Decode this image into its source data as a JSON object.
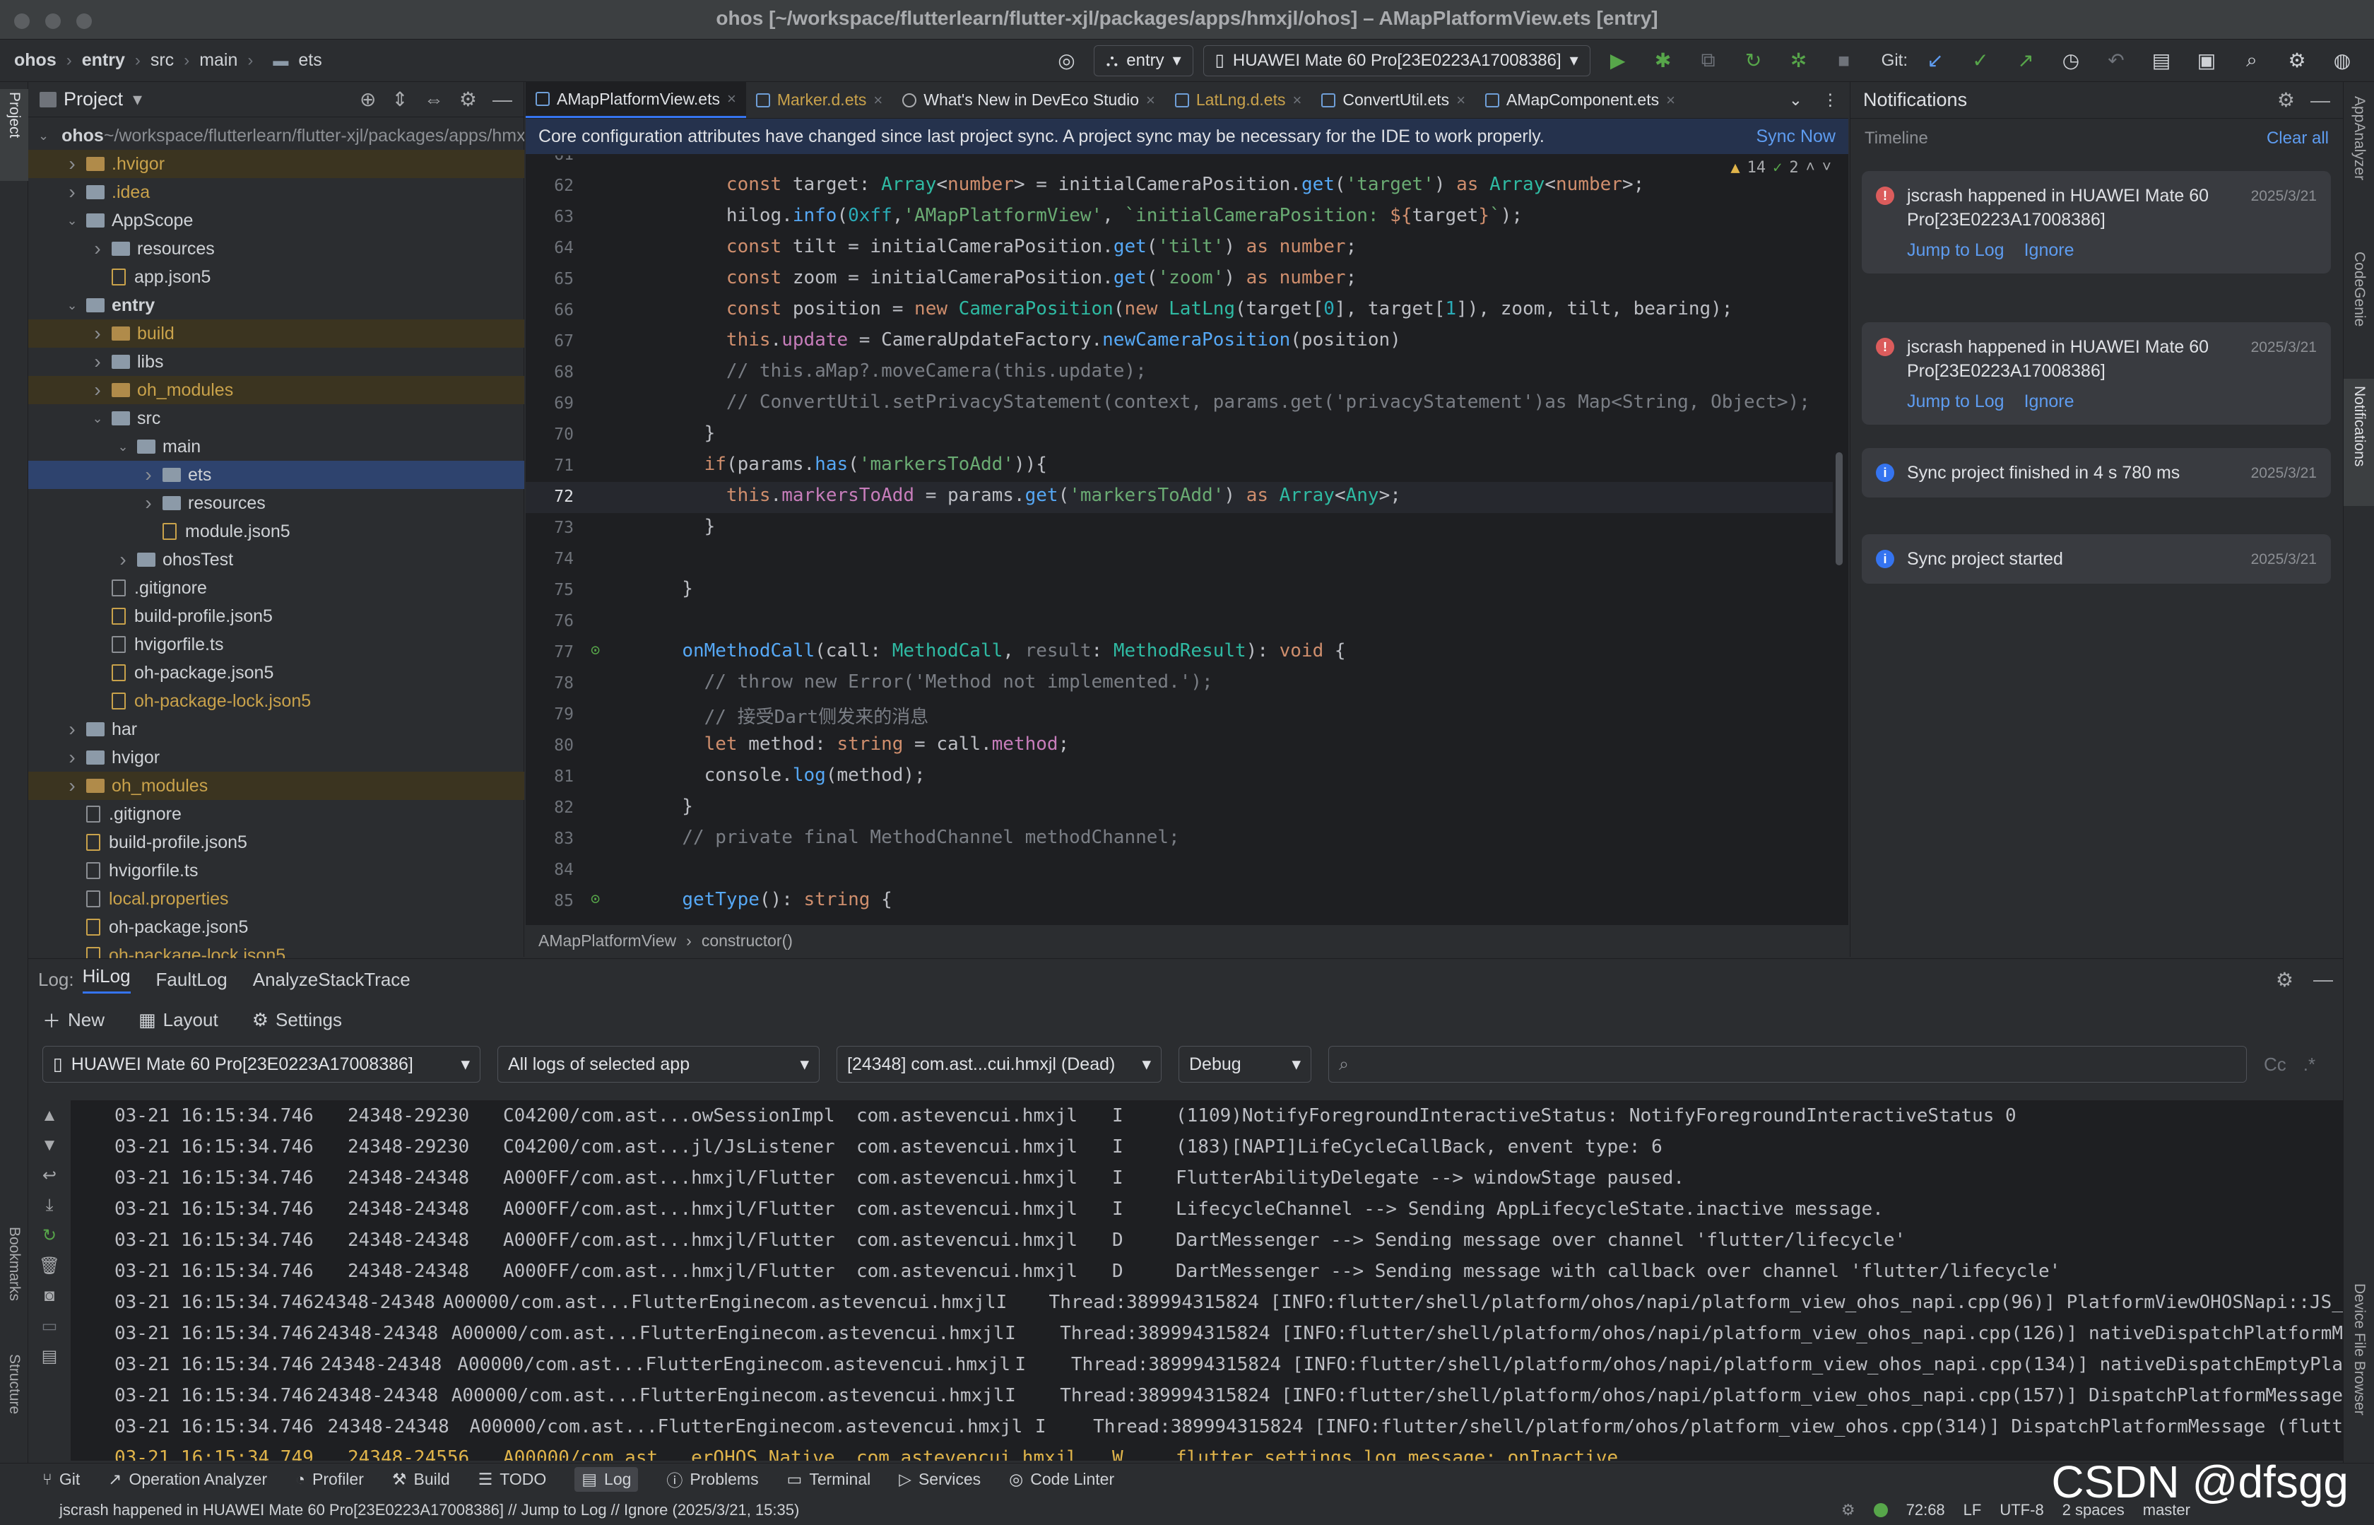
{
  "window": {
    "title": "ohos [~/workspace/flutterlearn/flutter-xjl/packages/apps/hmxjl/ohos] – AMapPlatformView.ets [entry]"
  },
  "toolbar": {
    "breadcrumb": [
      "ohos",
      "entry",
      "src",
      "main",
      "ets"
    ],
    "module": "entry",
    "device": "HUAWEI Mate 60 Pro[23E0223A17008386]",
    "git_label": "Git:"
  },
  "left_strip": {
    "project": "Project",
    "bookmarks": "Bookmarks",
    "structure": "Structure"
  },
  "right_strip": {
    "appanalyzer": "AppAnalyzer",
    "codegenie": "CodeGenie",
    "notifications": "Notifications",
    "device_file_browser": "Device File Browser"
  },
  "project": {
    "title": "Project",
    "tree": [
      {
        "name": "ohos",
        "extra": " ~/workspace/flutterlearn/flutter-xjl/packages/apps/hmxjl/ohos",
        "depth": 0,
        "arrow": "down",
        "icon": "folder",
        "bold": true
      },
      {
        "name": ".hvigor",
        "depth": 1,
        "arrow": "right",
        "icon": "folder-org",
        "color": "#c9a24b",
        "hl": "yellow"
      },
      {
        "name": ".idea",
        "depth": 1,
        "arrow": "right",
        "icon": "folder",
        "color": "#c9a24b"
      },
      {
        "name": "AppScope",
        "depth": 1,
        "arrow": "down",
        "icon": "folder"
      },
      {
        "name": "resources",
        "depth": 2,
        "arrow": "right",
        "icon": "folder"
      },
      {
        "name": "app.json5",
        "depth": 2,
        "arrow": "",
        "icon": "file-j"
      },
      {
        "name": "entry",
        "depth": 1,
        "arrow": "down",
        "icon": "folder",
        "bold": true
      },
      {
        "name": "build",
        "depth": 2,
        "arrow": "right",
        "icon": "folder-org",
        "color": "#c9a24b",
        "hl": "yellow"
      },
      {
        "name": "libs",
        "depth": 2,
        "arrow": "right",
        "icon": "folder"
      },
      {
        "name": "oh_modules",
        "depth": 2,
        "arrow": "right",
        "icon": "folder-org",
        "color": "#c9a24b",
        "hl": "yellow"
      },
      {
        "name": "src",
        "depth": 2,
        "arrow": "down",
        "icon": "folder"
      },
      {
        "name": "main",
        "depth": 3,
        "arrow": "down",
        "icon": "folder"
      },
      {
        "name": "ets",
        "depth": 4,
        "arrow": "right",
        "icon": "folder",
        "hl": "sel"
      },
      {
        "name": "resources",
        "depth": 4,
        "arrow": "right",
        "icon": "folder"
      },
      {
        "name": "module.json5",
        "depth": 4,
        "arrow": "",
        "icon": "file-j"
      },
      {
        "name": "ohosTest",
        "depth": 3,
        "arrow": "right",
        "icon": "folder"
      },
      {
        "name": ".gitignore",
        "depth": 2,
        "arrow": "",
        "icon": "file"
      },
      {
        "name": "build-profile.json5",
        "depth": 2,
        "arrow": "",
        "icon": "file-j"
      },
      {
        "name": "hvigorfile.ts",
        "depth": 2,
        "arrow": "",
        "icon": "file"
      },
      {
        "name": "oh-package.json5",
        "depth": 2,
        "arrow": "",
        "icon": "file-j"
      },
      {
        "name": "oh-package-lock.json5",
        "depth": 2,
        "arrow": "",
        "icon": "file-j",
        "color": "#c9a24b"
      },
      {
        "name": "har",
        "depth": 1,
        "arrow": "right",
        "icon": "folder"
      },
      {
        "name": "hvigor",
        "depth": 1,
        "arrow": "right",
        "icon": "folder"
      },
      {
        "name": "oh_modules",
        "depth": 1,
        "arrow": "right",
        "icon": "folder-org",
        "color": "#c9a24b",
        "hl": "yellow"
      },
      {
        "name": ".gitignore",
        "depth": 1,
        "arrow": "",
        "icon": "file"
      },
      {
        "name": "build-profile.json5",
        "depth": 1,
        "arrow": "",
        "icon": "file-j"
      },
      {
        "name": "hvigorfile.ts",
        "depth": 1,
        "arrow": "",
        "icon": "file"
      },
      {
        "name": "local.properties",
        "depth": 1,
        "arrow": "",
        "icon": "file",
        "color": "#c9a24b"
      },
      {
        "name": "oh-package.json5",
        "depth": 1,
        "arrow": "",
        "icon": "file-j"
      },
      {
        "name": "oh-package-lock.json5",
        "depth": 1,
        "arrow": "",
        "icon": "file-j",
        "color": "#c9a24b"
      }
    ]
  },
  "editor": {
    "tabs": [
      {
        "label": "AMapPlatformView.ets",
        "active": true,
        "color": "#dfe1e5"
      },
      {
        "label": "Marker.d.ets",
        "color": "#c9a24b"
      },
      {
        "label": "What's New in DevEco Studio",
        "color": "#dfe1e5"
      },
      {
        "label": "LatLng.d.ets",
        "color": "#c9a24b"
      },
      {
        "label": "ConvertUtil.ets",
        "color": "#dfe1e5"
      },
      {
        "label": "AMapComponent.ets",
        "color": "#dfe1e5"
      }
    ],
    "banner_text": "Core configuration attributes have changed since last project sync. A project sync may be necessary for the IDE to work properly.",
    "banner_link": "Sync Now",
    "warnings": "14",
    "checks": "2",
    "breadcrumb": [
      "AMapPlatformView",
      "constructor()"
    ],
    "lines": [
      {
        "n": "61",
        "html": ""
      },
      {
        "n": "62",
        "html": "      <span class=\"kw\">const</span> target: <span class=\"ty\">Array</span>&lt;<span class=\"kw\">number</span>&gt; = initialCameraPosition.<span class=\"fn\">get</span>(<span class=\"str\">'target'</span>) <span class=\"kw\">as</span> <span class=\"ty\">Array</span>&lt;<span class=\"kw\">number</span>&gt;;"
      },
      {
        "n": "63",
        "html": "      hilog.<span class=\"fn\">info</span>(<span class=\"num\">0xff</span>,<span class=\"str\">'AMapPlatformView'</span>, <span class=\"str\">`initialCameraPosition: </span><span class=\"kw\">${</span>target<span class=\"kw\">}</span><span class=\"str\">`</span>);"
      },
      {
        "n": "64",
        "html": "      <span class=\"kw\">const</span> tilt = initialCameraPosition.<span class=\"fn\">get</span>(<span class=\"str\">'tilt'</span>) <span class=\"kw\">as</span> <span class=\"kw\">number</span>;"
      },
      {
        "n": "65",
        "html": "      <span class=\"kw\">const</span> zoom = initialCameraPosition.<span class=\"fn\">get</span>(<span class=\"str\">'zoom'</span>) <span class=\"kw\">as</span> <span class=\"kw\">number</span>;"
      },
      {
        "n": "66",
        "html": "      <span class=\"kw\">const</span> position = <span class=\"kw\">new</span> <span class=\"ty\">CameraPosition</span>(<span class=\"kw\">new</span> <span class=\"ty\">LatLng</span>(target[<span class=\"num\">0</span>], target[<span class=\"num\">1</span>]), zoom, tilt, bearing);"
      },
      {
        "n": "67",
        "html": "      <span class=\"kw\">this</span>.<span class=\"pr\">update</span> = CameraUpdateFactory.<span class=\"fn\">newCameraPosition</span>(position)"
      },
      {
        "n": "68",
        "html": "      <span class=\"cm\">// this.aMap?.moveCamera(this.update);</span>"
      },
      {
        "n": "69",
        "html": "      <span class=\"cm\">// ConvertUtil.setPrivacyStatement(context, params.get('privacyStatement')as Map&lt;String, Object&gt;);</span>"
      },
      {
        "n": "70",
        "html": "    }"
      },
      {
        "n": "71",
        "html": "    <span class=\"kw\">if</span>(params.<span class=\"fn\">has</span>(<span class=\"str\">'markersToAdd'</span>)){"
      },
      {
        "n": "72",
        "html": "      <span class=\"kw\">this</span>.<span class=\"pr\">markersToAdd</span> = params.<span class=\"fn\">get</span>(<span class=\"str\">'markersToAdd'</span>) <span class=\"kw\">as</span> <span class=\"ty\">Array</span>&lt;<span class=\"ty\">Any</span>&gt;;"
      },
      {
        "n": "73",
        "html": "    }"
      },
      {
        "n": "74",
        "html": ""
      },
      {
        "n": "75",
        "html": "  }"
      },
      {
        "n": "76",
        "html": ""
      },
      {
        "n": "77",
        "html": "  <span class=\"fn\">onMethodCall</span>(call: <span class=\"ty\">MethodCall</span>, <span class=\"cm\">result</span>: <span class=\"ty\">MethodResult</span>): <span class=\"kw\">void</span> {"
      },
      {
        "n": "78",
        "html": "    <span class=\"cm\">// throw new Error('Method not implemented.');</span>"
      },
      {
        "n": "79",
        "html": "    <span class=\"cm\">// 接受Dart侧发来的消息</span>"
      },
      {
        "n": "80",
        "html": "    <span class=\"kw\">let</span> method: <span class=\"kw\">string</span> = call.<span class=\"pr\">method</span>;"
      },
      {
        "n": "81",
        "html": "    console.<span class=\"fn\">log</span>(method);"
      },
      {
        "n": "82",
        "html": "  }"
      },
      {
        "n": "83",
        "html": "  <span class=\"cm\">// private final MethodChannel methodChannel;</span>"
      },
      {
        "n": "84",
        "html": ""
      },
      {
        "n": "85",
        "html": "  <span class=\"fn\">getType</span>(): <span class=\"kw\">string</span> {"
      }
    ]
  },
  "notifications": {
    "title": "Notifications",
    "timeline": "Timeline",
    "clear_all": "Clear all",
    "items": [
      {
        "type": "error",
        "msg": "jscrash happened in HUAWEI Mate 60 Pro[23E0223A17008386]",
        "date": "2025/3/21",
        "jump": "Jump to Log",
        "ignore": "Ignore"
      },
      {
        "type": "error",
        "msg": "jscrash happened in HUAWEI Mate 60 Pro[23E0223A17008386]",
        "date": "2025/3/21",
        "jump": "Jump to Log",
        "ignore": "Ignore"
      },
      {
        "type": "info",
        "msg": "Sync project finished in 4 s 780 ms",
        "date": "2025/3/21"
      },
      {
        "type": "info",
        "msg": "Sync project started",
        "date": "2025/3/21"
      }
    ]
  },
  "log": {
    "label": "Log:",
    "tabs": [
      "HiLog",
      "FaultLog",
      "AnalyzeStackTrace"
    ],
    "tools": {
      "new": "New",
      "layout": "Layout",
      "settings": "Settings"
    },
    "device": "HUAWEI Mate 60 Pro[23E0223A17008386]",
    "scope": "All logs of selected app",
    "process": "[24348] com.ast...cui.hmxjl (Dead)",
    "level": "Debug",
    "search_placeholder": "",
    "cc": "Cc",
    "regex": ".*",
    "rows": [
      [
        "03-21 16:15:34.746",
        "24348-29230",
        "C04200/com.ast...owSessionImpl",
        "com.astevencui.hmxjl",
        "I",
        "(1109)NotifyForegroundInteractiveStatus: NotifyForegroundInteractiveStatus 0"
      ],
      [
        "03-21 16:15:34.746",
        "24348-29230",
        "C04200/com.ast...jl/JsListener",
        "com.astevencui.hmxjl",
        "I",
        "(183)[NAPI]LifeCycleCallBack, envent type: 6"
      ],
      [
        "03-21 16:15:34.746",
        "24348-24348",
        "A000FF/com.ast...hmxjl/Flutter",
        "com.astevencui.hmxjl",
        "I",
        "FlutterAbilityDelegate --> windowStage paused."
      ],
      [
        "03-21 16:15:34.746",
        "24348-24348",
        "A000FF/com.ast...hmxjl/Flutter",
        "com.astevencui.hmxjl",
        "I",
        "LifecycleChannel --> Sending AppLifecycleState.inactive message."
      ],
      [
        "03-21 16:15:34.746",
        "24348-24348",
        "A000FF/com.ast...hmxjl/Flutter",
        "com.astevencui.hmxjl",
        "D",
        "DartMessenger --> Sending message over channel 'flutter/lifecycle'"
      ],
      [
        "03-21 16:15:34.746",
        "24348-24348",
        "A000FF/com.ast...hmxjl/Flutter",
        "com.astevencui.hmxjl",
        "D",
        "DartMessenger --> Sending message with callback over channel 'flutter/lifecycle'"
      ],
      [
        "03-21 16:15:34.746",
        "24348-24348",
        "A00000/com.ast...FlutterEngine",
        "com.astevencui.hmxjl",
        "I",
        "Thread:389994315824  [INFO:flutter/shell/platform/ohos/napi/platform_view_ohos_napi.cpp(96)] PlatformViewOHOSNapi::JS_"
      ],
      [
        "03-21 16:15:34.746",
        "24348-24348",
        "A00000/com.ast...FlutterEngine",
        "com.astevencui.hmxjl",
        "I",
        "Thread:389994315824  [INFO:flutter/shell/platform/ohos/napi/platform_view_ohos_napi.cpp(126)] nativeDispatchPlatformM"
      ],
      [
        "03-21 16:15:34.746",
        "24348-24348",
        "A00000/com.ast...FlutterEngine",
        "com.astevencui.hmxjl",
        "I",
        "Thread:389994315824  [INFO:flutter/shell/platform/ohos/napi/platform_view_ohos_napi.cpp(134)] nativeDispatchEmptyPla"
      ],
      [
        "03-21 16:15:34.746",
        "24348-24348",
        "A00000/com.ast...FlutterEngine",
        "com.astevencui.hmxjl",
        "I",
        "Thread:389994315824  [INFO:flutter/shell/platform/ohos/napi/platform_view_ohos_napi.cpp(157)] DispatchPlatformMessage"
      ],
      [
        "03-21 16:15:34.746",
        "24348-24348",
        "A00000/com.ast...FlutterEngine",
        "com.astevencui.hmxjl",
        "I",
        "Thread:389994315824  [INFO:flutter/shell/platform/ohos/platform_view_ohos.cpp(314)] DispatchPlatformMessage (flutt"
      ],
      [
        "03-21 16:15:34.749",
        "24348-24556",
        "A00000/com.ast...erOHOS Native",
        "com.astevencui.hmxjl",
        "W",
        "flutter settings log message: onInactive"
      ]
    ]
  },
  "bottom_tools": [
    "Git",
    "Operation Analyzer",
    "Profiler",
    "Build",
    "TODO",
    "Log",
    "Problems",
    "Terminal",
    "Services",
    "Code Linter"
  ],
  "status": {
    "message": "jscrash happened in HUAWEI Mate 60 Pro[23E0223A17008386] // Jump to Log // Ignore (2025/3/21, 15:35)",
    "position": "72:68",
    "line_sep": "LF",
    "encoding": "UTF-8",
    "indent": "2 spaces",
    "branch": "master"
  },
  "watermark": "CSDN @dfsgg"
}
